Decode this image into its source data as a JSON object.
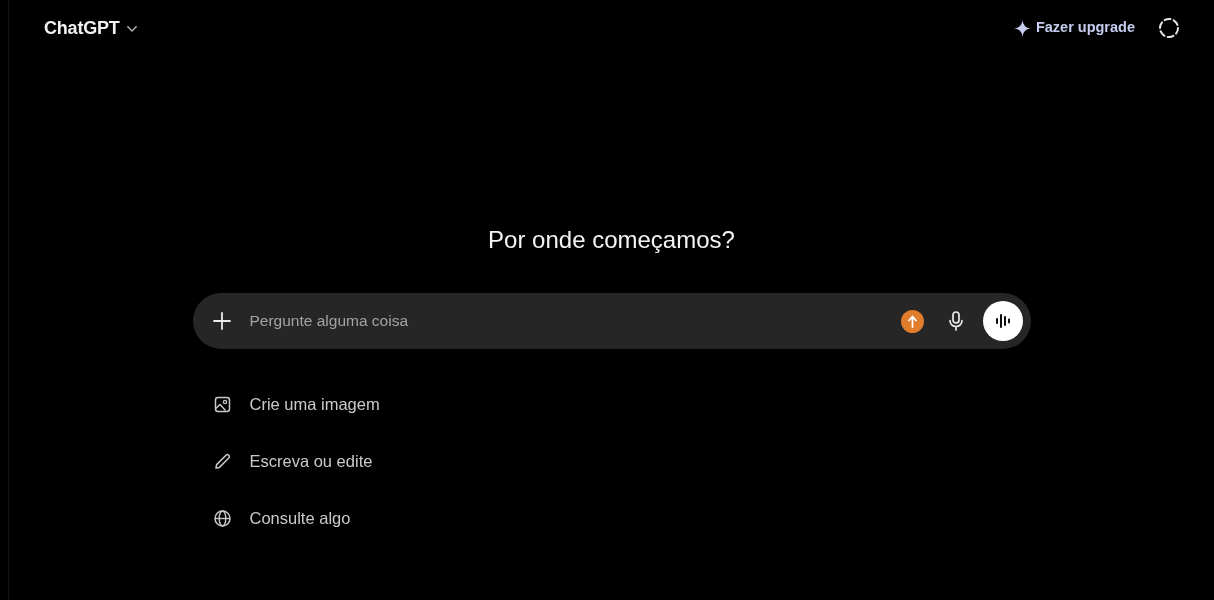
{
  "header": {
    "title": "ChatGPT",
    "upgrade_button": "Fazer upgrade"
  },
  "heading": "Por onde começamos?",
  "composer": {
    "placeholder": "Pergunte alguma coisa"
  },
  "suggestions": [
    {
      "kind": "image",
      "label": "Crie uma imagem"
    },
    {
      "kind": "write",
      "label": "Escreva ou edite"
    },
    {
      "kind": "search",
      "label": "Consulte algo"
    }
  ]
}
